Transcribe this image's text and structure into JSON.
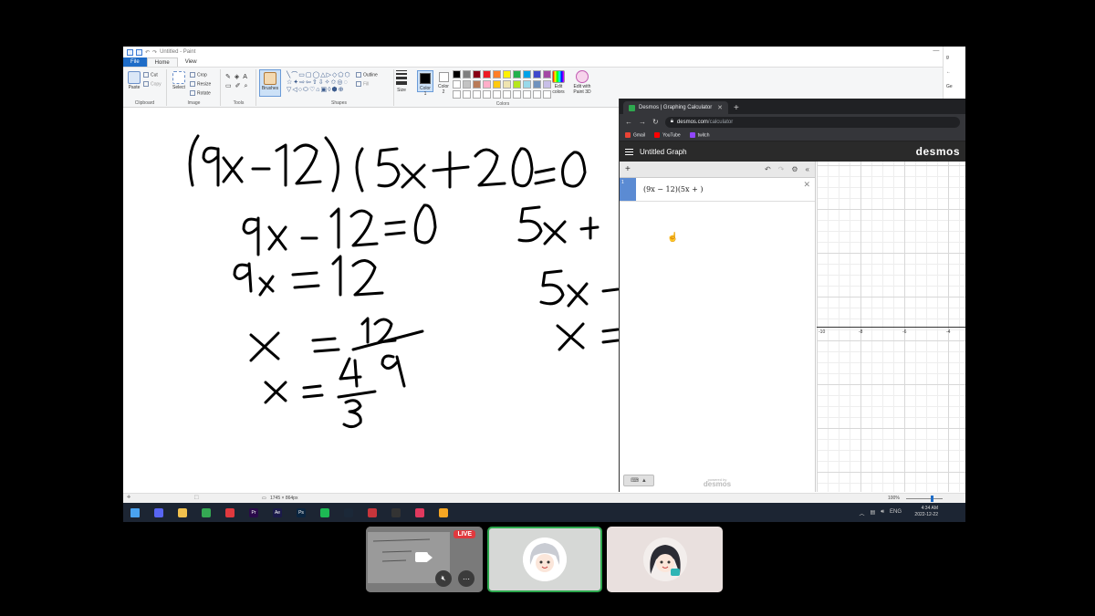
{
  "paint": {
    "window_title": "Untitled - Paint",
    "tabs": [
      "File",
      "Home",
      "View"
    ],
    "clipboard": {
      "paste": "Paste",
      "cut": "Cut",
      "copy": "Copy",
      "label": "Clipboard"
    },
    "image": {
      "select": "Select",
      "crop": "Crop",
      "resize": "Resize",
      "rotate": "Rotate",
      "label": "Image"
    },
    "tools": {
      "label": "Tools",
      "text_tool": "A"
    },
    "brushes": "Brushes",
    "shapes": {
      "label": "Shapes",
      "outline": "Outline",
      "fill": "Fill"
    },
    "size": "Size",
    "color1": "Color 1",
    "color2": "Color 2",
    "colors_label": "Colors",
    "edit_colors": "Edit colors",
    "edit_paint3d": "Edit with Paint 3D",
    "palette": [
      "#000000",
      "#7f7f7f",
      "#880015",
      "#ed1c24",
      "#ff7f27",
      "#fff200",
      "#22b14c",
      "#00a2e8",
      "#3f48cc",
      "#a349a4",
      "#ffffff",
      "#c3c3c3",
      "#b97a57",
      "#ffaec9",
      "#ffc90e",
      "#efe4b0",
      "#b5e61d",
      "#99d9ea",
      "#7092be",
      "#c8bfe7",
      "#ffffff",
      "#ffffff",
      "#ffffff",
      "#ffffff",
      "#ffffff",
      "#ffffff",
      "#ffffff",
      "#ffffff",
      "#ffffff",
      "#ffffff"
    ],
    "status": {
      "dimensions": "1745 × 864px",
      "zoom": "100%"
    }
  },
  "chrome": {
    "tab_title": "Desmos | Graphing Calculator",
    "url_host": "desmos.com",
    "url_path": "/calculator",
    "bookmarks": [
      {
        "label": "Gmail",
        "color": "#ea4335"
      },
      {
        "label": "YouTube",
        "color": "#ff0000"
      },
      {
        "label": "twitch",
        "color": "#9146ff"
      }
    ],
    "sliver_items": [
      "g",
      "←",
      "Ge"
    ]
  },
  "desmos": {
    "graph_title": "Untitled Graph",
    "logo": "desmos",
    "expression_index": "1",
    "expression": "(9x − 12)(5x + )",
    "powered_by": "powered by",
    "powered_logo": "desmos",
    "x_ticks": [
      "-10",
      "-8",
      "-6",
      "-4"
    ]
  },
  "taskbar": {
    "apps": [
      {
        "name": "windows",
        "color": "#4aa3f0"
      },
      {
        "name": "discord",
        "color": "#5865f2"
      },
      {
        "name": "file-explorer",
        "color": "#f2c14e"
      },
      {
        "name": "chrome",
        "color": "#34a853"
      },
      {
        "name": "opera",
        "color": "#e0393e"
      },
      {
        "name": "premiere",
        "color": "#2a0a4a"
      },
      {
        "name": "after-effects",
        "color": "#1b1a4a"
      },
      {
        "name": "photoshop",
        "color": "#0a2540"
      },
      {
        "name": "spotify",
        "color": "#1db954"
      },
      {
        "name": "steam",
        "color": "#1b2838"
      },
      {
        "name": "app-red",
        "color": "#c7353b"
      },
      {
        "name": "app-x",
        "color": "#333333"
      },
      {
        "name": "app-pink",
        "color": "#e0395e"
      },
      {
        "name": "paint",
        "color": "#f5a623"
      }
    ],
    "app_labels": {
      "premiere": "Pr",
      "after-effects": "Ae",
      "photoshop": "Ps"
    },
    "language": "ENG",
    "time": "4:34 AM",
    "date": "2022-12-22"
  },
  "stream": {
    "live_label": "LIVE"
  }
}
